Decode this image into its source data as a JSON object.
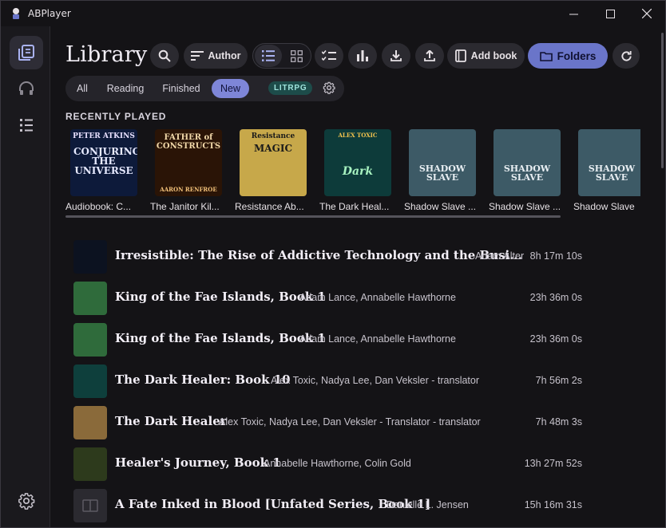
{
  "app": {
    "title": "ABPlayer"
  },
  "window_controls": {
    "minimize": "─",
    "maximize": "☐",
    "close": "✕"
  },
  "page": {
    "title": "Library"
  },
  "toolbar": {
    "author_label": "Author",
    "add_book_label": "Add book",
    "folders_label": "Folders"
  },
  "filters": {
    "all": "All",
    "reading": "Reading",
    "finished": "Finished",
    "new": "New",
    "tag": "LITRPG"
  },
  "recent": {
    "heading": "RECENTLY PLAYED",
    "items": [
      {
        "title": "Audiobook: C...",
        "cover_top": "PETER ATKINS",
        "cover_main": "CONJURING THE UNIVERSE",
        "bg": "#0d1a3a"
      },
      {
        "title": "The Janitor Kil...",
        "cover_top": "FATHER of",
        "cover_main": "CONSTRUCTS",
        "cover_bottom": "AARON RENFROE",
        "bg": "#2a1406"
      },
      {
        "title": "Resistance Ab...",
        "cover_top": "Resistance",
        "cover_main": "MAGIC",
        "bg": "#c7a84a"
      },
      {
        "title": "The Dark Heal...",
        "cover_top": "ALEX TOXIC",
        "cover_main": "Dark",
        "bg": "#0d3b3a"
      },
      {
        "title": "Shadow Slave ...",
        "cover_main": "SHADOW SLAVE",
        "bg": "#3d5a66"
      },
      {
        "title": "Shadow Slave ...",
        "cover_main": "SHADOW SLAVE",
        "bg": "#3d5a66"
      },
      {
        "title": "Shadow Slave",
        "cover_main": "SHADOW SLAVE",
        "bg": "#3d5a66"
      }
    ]
  },
  "books": [
    {
      "title": "Irresistible: The Rise of Addictive Technology and the Busi...",
      "author": "Adam Alter",
      "duration": "8h 17m 10s",
      "thumb": "#0c1220"
    },
    {
      "title": "King of the Fae Islands, Book 1",
      "author": "Adam Lance, Annabelle Hawthorne",
      "duration": "23h 36m 0s",
      "thumb": "#2f6b3b"
    },
    {
      "title": "King of the Fae Islands, Book 1",
      "author": "Adam Lance, Annabelle Hawthorne",
      "duration": "23h 36m 0s",
      "thumb": "#2f6b3b"
    },
    {
      "title": "The Dark Healer: Book 10",
      "author": "Alex Toxic, Nadya Lee, Dan Veksler - translator",
      "duration": "7h 56m 2s",
      "thumb": "#0e3f3c"
    },
    {
      "title": "The Dark Healer",
      "author": "Alex Toxic, Nadya Lee, Dan Veksler - Translator - translator",
      "duration": "7h 48m 3s",
      "thumb": "#8a6a3a"
    },
    {
      "title": "Healer's Journey, Book 1",
      "author": "Annabelle Hawthorne, Colin Gold",
      "duration": "13h 27m 52s",
      "thumb": "#2d3a1c"
    },
    {
      "title": "A Fate Inked in Blood [Unfated Series, Book 1]",
      "author": "Danielle L. Jensen",
      "duration": "15h 16m 31s",
      "thumb": "#2b2a30"
    }
  ]
}
